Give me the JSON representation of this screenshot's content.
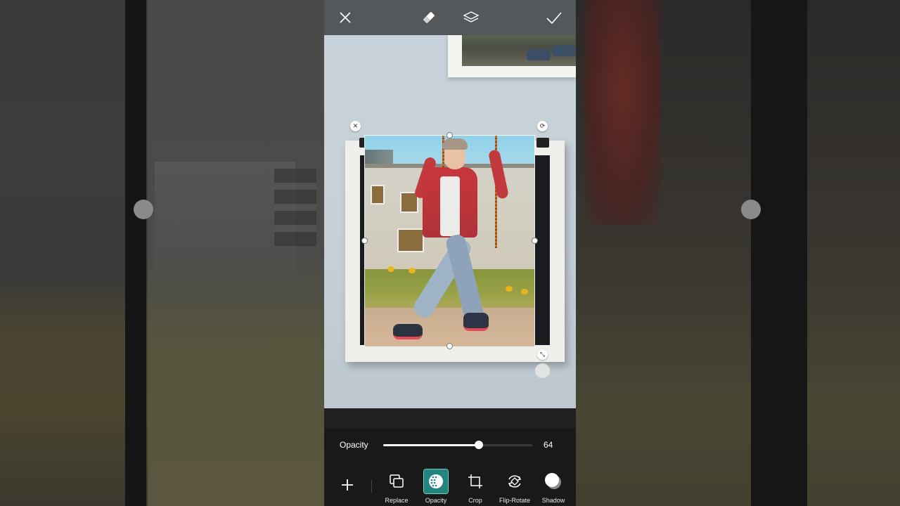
{
  "topbar": {
    "close_icon": "close-icon",
    "eraser_icon": "eraser-icon",
    "layers_icon": "layers-icon",
    "apply_icon": "checkmark-icon"
  },
  "opacity": {
    "label": "Opacity",
    "value": 64,
    "value_text": "64"
  },
  "tools": [
    {
      "label": "Replace",
      "icon": "replace-icon",
      "active": false
    },
    {
      "label": "Opacity",
      "icon": "opacity-icon",
      "active": true
    },
    {
      "label": "Crop",
      "icon": "crop-icon",
      "active": false
    },
    {
      "label": "Flip-Rotate",
      "icon": "flip-rotate-icon",
      "active": false
    },
    {
      "label": "Shadow",
      "icon": "shadow-icon",
      "active": false
    }
  ],
  "colors": {
    "accent": "#23847d",
    "toolbar_bg": "#191919"
  }
}
